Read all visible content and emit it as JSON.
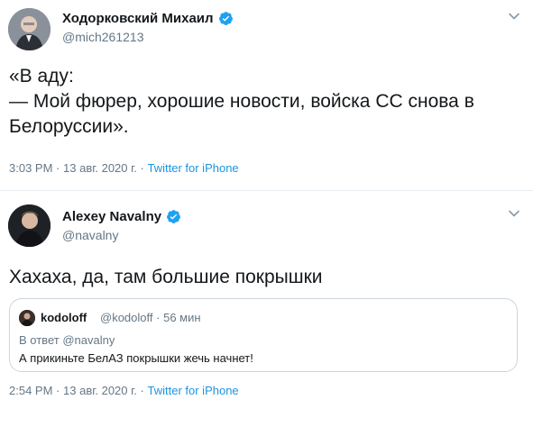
{
  "tweets": [
    {
      "author_name": "Ходорковский Михаил",
      "author_handle": "@mich261213",
      "text": "«В аду:\n— Мой фюрер, хорошие новости, войска СС снова в Белоруссии».",
      "time": "3:03 PM",
      "date": "13 авг. 2020 г.",
      "separator": "·",
      "source": "Twitter for iPhone"
    },
    {
      "author_name": "Alexey Navalny",
      "author_handle": "@navalny",
      "text": "Хахаха, да, там большие покрышки",
      "time": "2:54 PM",
      "date": "13 авг. 2020 г.",
      "separator": "·",
      "source": "Twitter for iPhone",
      "quote": {
        "author_name": "kodoloff",
        "author_handle": "@kodoloff",
        "separator": "·",
        "time_ago": "56 мин",
        "reply_prefix": "В ответ",
        "reply_to": "@navalny",
        "text": "А прикиньте БелАЗ покрышки жечь начнет!"
      }
    }
  ],
  "icons": {
    "verified": "verified-badge-icon",
    "chevron": "chevron-down-icon"
  },
  "colors": {
    "verified_blue": "#1da1f2",
    "link_blue": "#1b95e0",
    "secondary_text": "#657786",
    "primary_text": "#14171a"
  }
}
